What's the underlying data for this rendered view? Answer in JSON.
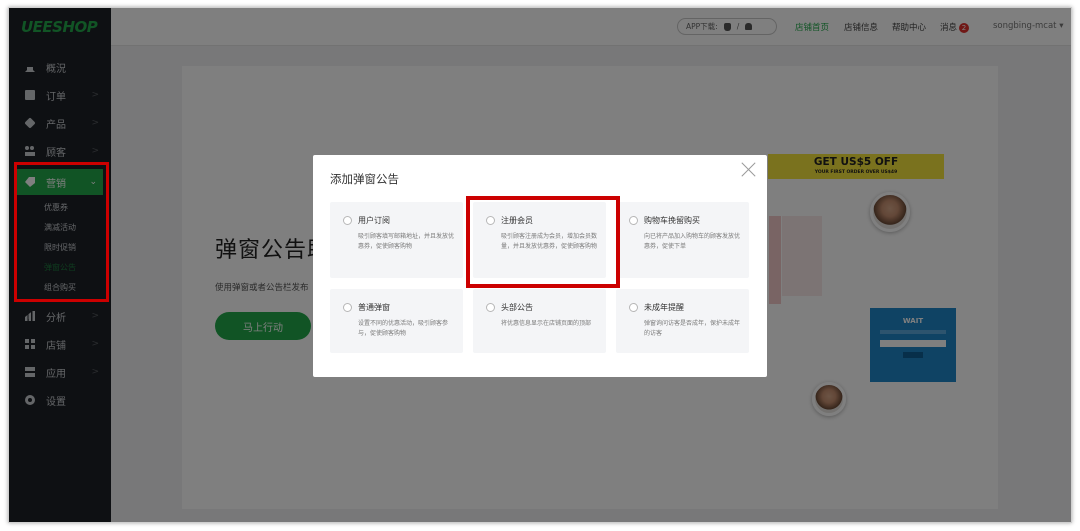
{
  "app": {
    "logo": "UEESHOP"
  },
  "sidebar": {
    "items": [
      {
        "label": "概況",
        "icon": "home-icon"
      },
      {
        "label": "订单",
        "icon": "clipboard-icon",
        "chevron": ">"
      },
      {
        "label": "产品",
        "icon": "box-icon",
        "chevron": ">"
      },
      {
        "label": "顾客",
        "icon": "users-icon",
        "chevron": ">"
      },
      {
        "label": "营销",
        "icon": "tag-icon",
        "chevron": "⌄",
        "active": true
      },
      {
        "label": "分析",
        "icon": "bar-chart-icon",
        "chevron": ">"
      },
      {
        "label": "店铺",
        "icon": "grid-icon",
        "chevron": ">"
      },
      {
        "label": "应用",
        "icon": "stack-icon",
        "chevron": ">"
      },
      {
        "label": "设置",
        "icon": "gear-icon"
      }
    ],
    "submenu": [
      "优惠券",
      "满减活动",
      "限时促销",
      "弹窗公告",
      "组合购买"
    ],
    "submenu_current": "弹窗公告"
  },
  "header": {
    "app_download": "APP下载:",
    "app_sep": "/",
    "links": {
      "store_home": "店铺首页",
      "store_info": "店铺信息",
      "help": "帮助中心",
      "messages": "消息",
      "messages_count": "2",
      "user": "songbing-mcat",
      "user_caret": "▾"
    }
  },
  "page": {
    "title": "弹窗公告助",
    "desc": "使用弹窗或者公告栏发布",
    "cta": "马上行动",
    "promo_big": "GET US$5 OFF",
    "promo_small": "YOUR FIRST ORDER OVER US$49",
    "wait_title": "WAIT"
  },
  "modal": {
    "title": "添加弹窗公告",
    "options": [
      {
        "title": "用户订阅",
        "desc": "吸引顾客填写邮箱地址，并且发放优惠券，促使顾客购物"
      },
      {
        "title": "注册会员",
        "desc": "吸引顾客注册成为会员，增加会员数量，并且发放优惠券，促使顾客购物"
      },
      {
        "title": "购物车挽留购买",
        "desc": "向已将产品加入购物车的顾客发放优惠券，促使下单"
      },
      {
        "title": "普通弹窗",
        "desc": "设置不同的优惠活动，吸引顾客参与，促使顾客购物"
      },
      {
        "title": "头部公告",
        "desc": "将优惠信息显示在店铺页面的顶部"
      },
      {
        "title": "未成年提醒",
        "desc": "弹窗询问访客是否成年，保护未成年的访客"
      }
    ]
  },
  "colors": {
    "brand_green": "#22a94b",
    "sidebar_bg": "#1d2126",
    "highlight_red": "#cc0000",
    "badge_red": "#e0302d",
    "promo_yellow": "#f5e43c",
    "wait_blue": "#1f87c9"
  }
}
